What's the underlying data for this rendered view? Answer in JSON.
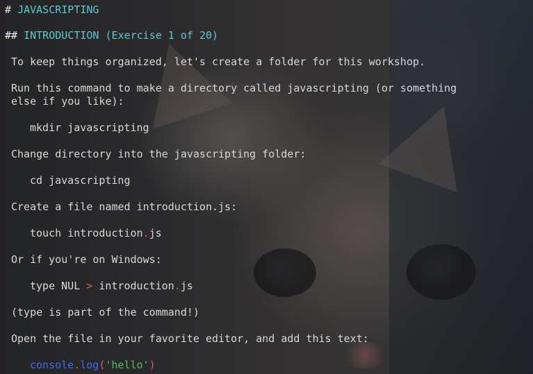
{
  "heading1": {
    "hash": "#",
    "title": "JAVASCRIPTING"
  },
  "heading2": {
    "hash": "##",
    "title": "INTRODUCTION (Exercise 1 of 20)"
  },
  "paragraphs": {
    "p1": "To keep things organized, let's create a folder for this workshop.",
    "p2_line1": "Run this command to make a directory called javascripting (or something",
    "p2_line2": "else if you like):",
    "p3": "Change directory into the javascripting folder:",
    "p4": "Create a file named introduction.js:",
    "p5": "Or if you're on Windows:",
    "p6": "(type is part of the command!)",
    "p7": "Open the file in your favorite editor, and add this text:"
  },
  "commands": {
    "mkdir": "mkdir javascripting",
    "cd": "cd javascripting",
    "touch_name": "touch introduction",
    "touch_dot": ".",
    "touch_ext": "js",
    "type_cmd": "type NUL ",
    "type_op": ">",
    "type_file": " introduction",
    "type_dot": ".",
    "type_ext": "js"
  },
  "code": {
    "obj": "console",
    "dot": ".",
    "method": "log",
    "open_paren": "(",
    "string": "'hello'",
    "close_paren": ")"
  },
  "colors": {
    "heading": "#5fc7cf",
    "text": "#d8d8d8",
    "operator": "#e05a5a",
    "keyword": "#3b6df0",
    "string": "#4fbf5a"
  }
}
